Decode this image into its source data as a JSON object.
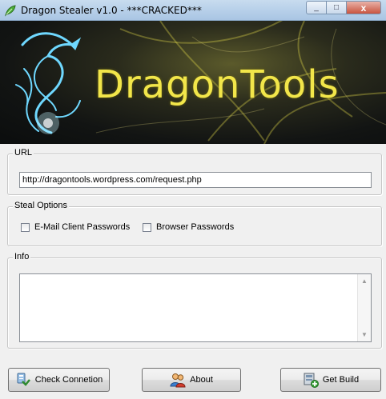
{
  "window": {
    "title": "Dragon Stealer v1.0 - ***CRACKED***",
    "app_icon": "leaf-icon",
    "controls": {
      "minimize": "_",
      "maximize": "□",
      "close": "x"
    }
  },
  "banner": {
    "text": "DragonTools",
    "logo": "dragon-logo"
  },
  "url_group": {
    "label": "URL",
    "value": "http://dragontools.wordpress.com/request.php"
  },
  "steal_options": {
    "label": "Steal Options",
    "email": {
      "label": "E-Mail Client Passwords",
      "checked": false
    },
    "browser": {
      "label": "Browser Passwords",
      "checked": false
    }
  },
  "info": {
    "label": "Info",
    "value": "",
    "scroll_up": "▲",
    "scroll_down": "▼"
  },
  "buttons": {
    "check": {
      "label": "Check Connetion",
      "icon": "network-check-icon"
    },
    "about": {
      "label": "About",
      "icon": "users-icon"
    },
    "build": {
      "label": "Get Build",
      "icon": "build-add-icon"
    }
  },
  "colors": {
    "banner_text": "#f2e64a",
    "dragon": "#6fd8ff"
  }
}
